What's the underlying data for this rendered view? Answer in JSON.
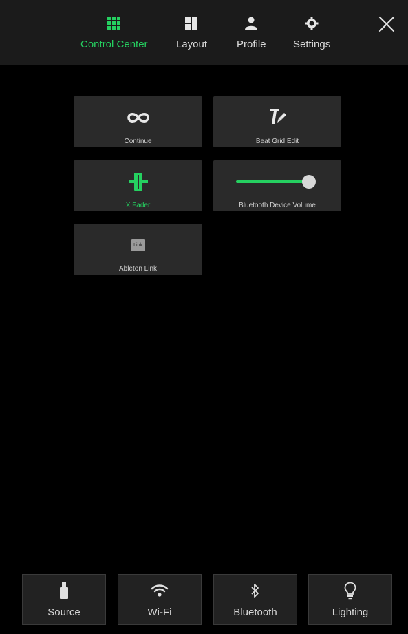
{
  "nav": {
    "tabs": [
      {
        "label": "Control Center",
        "icon": "grid-icon",
        "active": true
      },
      {
        "label": "Layout",
        "icon": "layout-icon",
        "active": false
      },
      {
        "label": "Profile",
        "icon": "person-icon",
        "active": false
      },
      {
        "label": "Settings",
        "icon": "gear-icon",
        "active": false
      }
    ],
    "close_icon": "close-icon"
  },
  "tiles": [
    {
      "label": "Continue",
      "icon": "infinity-icon"
    },
    {
      "label": "Beat Grid Edit",
      "icon": "beat-grid-edit-icon"
    },
    {
      "label": "X Fader",
      "icon": "crossfader-icon",
      "accent": true
    },
    {
      "label": "Bluetooth Device Volume",
      "icon": "volume-slider",
      "volume_level": 0.88
    },
    {
      "label": "Ableton Link",
      "icon": "link-badge-icon",
      "badge_text": "Link"
    }
  ],
  "bottom": [
    {
      "label": "Source",
      "icon": "usb-drive-icon"
    },
    {
      "label": "Wi-Fi",
      "icon": "wifi-icon"
    },
    {
      "label": "Bluetooth",
      "icon": "bluetooth-icon"
    },
    {
      "label": "Lighting",
      "icon": "bulb-icon"
    }
  ],
  "colors": {
    "accent": "#25d060",
    "background": "#000000",
    "topbar": "#1b1b1b",
    "tile": "#2a2a2a"
  }
}
